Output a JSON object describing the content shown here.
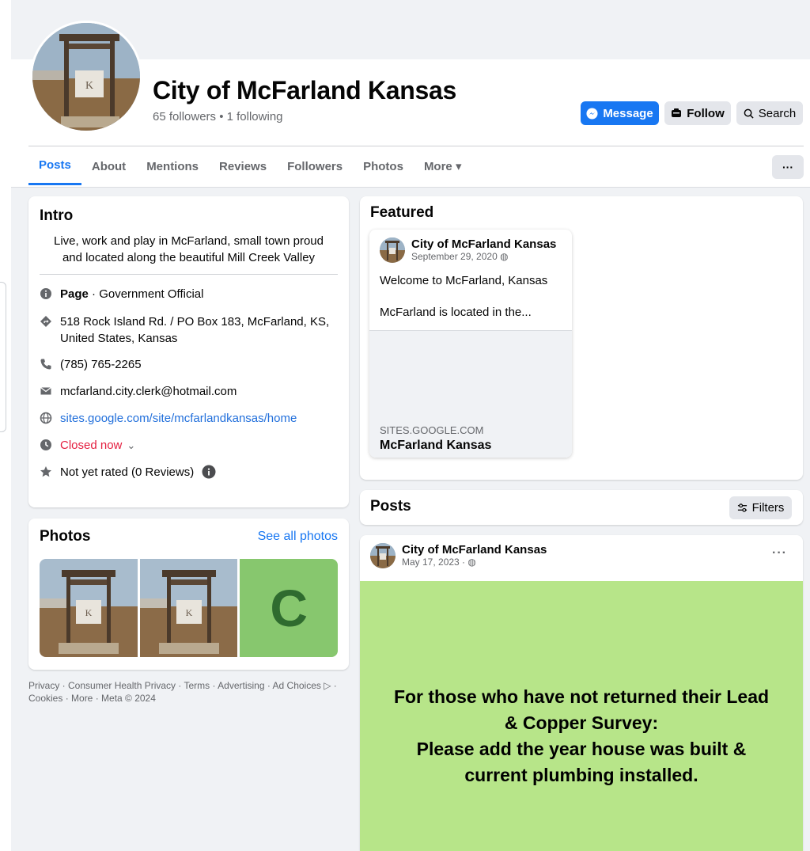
{
  "page": {
    "name": "City of McFarland Kansas",
    "stats": "65 followers • 1 following"
  },
  "actions": {
    "message": "Message",
    "follow": "Follow",
    "search": "Search"
  },
  "tabs": [
    {
      "label": "Posts",
      "active": true
    },
    {
      "label": "About"
    },
    {
      "label": "Mentions"
    },
    {
      "label": "Reviews"
    },
    {
      "label": "Followers"
    },
    {
      "label": "Photos"
    },
    {
      "label": "More ▾"
    }
  ],
  "more_menu": "···",
  "intro": {
    "title": "Intro",
    "bio": "Live, work and play in McFarland, small town proud and located along the beautiful Mill Creek Valley",
    "page_label": "Page",
    "page_category": " · Government Official",
    "address": "518 Rock Island Rd. / PO Box 183, McFarland, KS, United States, Kansas",
    "phone": "(785) 765-2265",
    "email": "mcfarland.city.clerk@hotmail.com",
    "website": "sites.google.com/site/mcfarlandkansas/home",
    "hours": "Closed now",
    "hours_chevron": "⌄",
    "rating": "Not yet rated (0 Reviews)"
  },
  "photos": {
    "title": "Photos",
    "see_all": "See all photos",
    "tile_letter": "C"
  },
  "footer": {
    "text": "Privacy · Consumer Health Privacy · Terms · Advertising · Ad Choices ▷ · Cookies · More · Meta © 2024"
  },
  "featured": {
    "title": "Featured",
    "author": "City of McFarland Kansas",
    "date": "September 29, 2020",
    "text1": "Welcome to McFarland, Kansas",
    "text2": "McFarland is located in the...",
    "link_domain": "SITES.GOOGLE.COM",
    "link_title": "McFarland Kansas"
  },
  "posts_section": {
    "title": "Posts",
    "filters": "Filters"
  },
  "post": {
    "author": "City of McFarland Kansas",
    "date": "May 17, 2023 ·",
    "menu": "···",
    "image_line1": "For those who have not returned their Lead",
    "image_line2": "& Copper Survey:",
    "image_line3": "Please add the year house was built &",
    "image_line4": "current plumbing installed."
  },
  "colors": {
    "primary": "#1877f2",
    "link": "#216fdb",
    "closed": "#e41e3f",
    "post_bg": "#b7e589"
  }
}
